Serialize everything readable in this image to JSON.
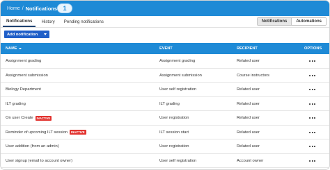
{
  "breadcrumb": {
    "home": "Home",
    "separator": "/",
    "current": "Notifications"
  },
  "step_marker": "1",
  "tabs": [
    {
      "label": "Notifications",
      "active": true
    },
    {
      "label": "History",
      "active": false
    },
    {
      "label": "Pending notifications",
      "active": false
    }
  ],
  "view_toggle": [
    {
      "label": "Notifications",
      "active": true
    },
    {
      "label": "Automations",
      "active": false
    }
  ],
  "add_button": {
    "label": "Add notification"
  },
  "table": {
    "columns": [
      "NAME",
      "EVENT",
      "RECIPIENT",
      "OPTIONS"
    ],
    "rows": [
      {
        "name": "Assignment grading",
        "badge": "",
        "event": "Assignment grading",
        "recipient": "Related user"
      },
      {
        "name": "Assignment submission",
        "badge": "",
        "event": "Assignment submission",
        "recipient": "Course instructors"
      },
      {
        "name": "Biology Department",
        "badge": "",
        "event": "User self registration",
        "recipient": "Related user"
      },
      {
        "name": "ILT grading",
        "badge": "",
        "event": "ILT grading",
        "recipient": "Related user"
      },
      {
        "name": "On user Create",
        "badge": "INACTIVE",
        "event": "User registration",
        "recipient": "Related user"
      },
      {
        "name": "Reminder of upcoming ILT session",
        "badge": "INACTIVE",
        "event": "ILT session start",
        "recipient": "Related user"
      },
      {
        "name": "User addition (from an admin)",
        "badge": "",
        "event": "User registration",
        "recipient": "Related user"
      },
      {
        "name": "User signup (email to account owner)",
        "badge": "",
        "event": "User self registration",
        "recipient": "Account owner"
      }
    ]
  },
  "colors": {
    "header_blue": "#1e8ad6",
    "button_blue": "#1f5fc8",
    "inactive_badge": "#e2332f"
  }
}
